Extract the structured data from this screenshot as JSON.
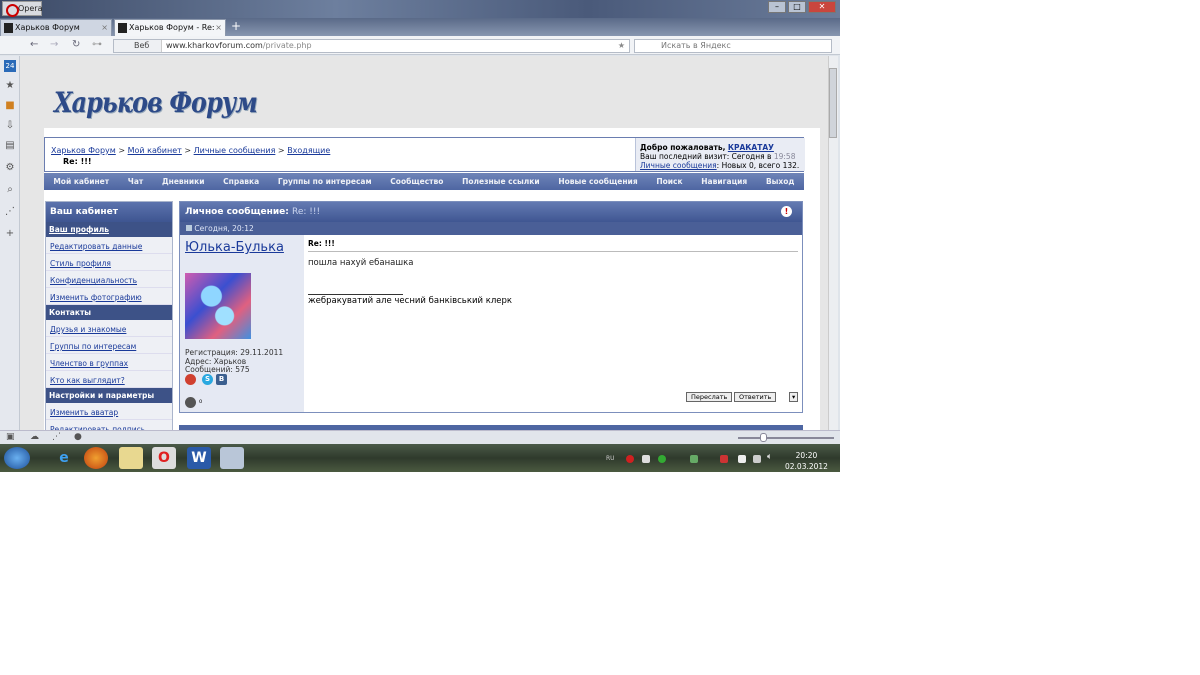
{
  "browser": {
    "menu_label": "Opera",
    "tabs": [
      {
        "label": "Харьков Форум"
      },
      {
        "label": "Харьков Форум - Re: !!!"
      }
    ],
    "address": {
      "mode": "Веб",
      "host": "www.kharkovforum.com",
      "path": "/private.php"
    },
    "search_placeholder": "Искать в Яндекс",
    "speed_dial_badge": "24"
  },
  "site": {
    "logo": "Харьков Форум",
    "breadcrumb": [
      "Харьков Форум",
      "Мой кабинет",
      "Личные сообщения",
      "Входящие"
    ],
    "current_title": "Re: !!!",
    "welcome": {
      "greeting": "Добро пожаловать,",
      "user": "КРАКАТАУ",
      "last_visit_label": "Ваш последний визит: Сегодня в",
      "last_visit_time": "19:58",
      "pm_link": "Личные сообщения",
      "pm_stats": ": Новых 0, всего 132."
    },
    "nav": [
      "Мой кабинет",
      "Чат",
      "Дневники",
      "Справка",
      "Группы по интересам",
      "Сообщество",
      "Полезные ссылки",
      "Новые сообщения",
      "Поиск",
      "Навигация",
      "Выход"
    ]
  },
  "sidebar": {
    "title": "Ваш кабинет",
    "sections": [
      {
        "label": "Ваш профиль",
        "items": [
          "Редактировать данные",
          "Стиль профиля",
          "Конфиденциальность",
          "Изменить фотографию"
        ]
      },
      {
        "label": "Контакты",
        "items": [
          "Друзья и знакомые",
          "Группы по интересам",
          "Членство в группах",
          "Кто как выглядит?"
        ]
      },
      {
        "label": "Настройки и параметры",
        "items": [
          "Изменить аватар",
          "Редактировать подпись"
        ]
      }
    ]
  },
  "message": {
    "header_label": "Личное сообщение:",
    "header_title": "Re: !!!",
    "date": "Сегодня, 20:12",
    "author": "Юлька-Булька",
    "registration": "Регистрация: 29.11.2011",
    "address": "Адрес: Харьков",
    "posts": "Сообщений: 575",
    "subject": "Re: !!!",
    "body": "пошла нахуй ебанашка",
    "signature": "жебракуватий але чесний банківський клерк",
    "forward_label": "Переслать",
    "reply_label": "Ответить"
  },
  "taskbar": {
    "time": "20:20",
    "date": "02.03.2012",
    "lang": "RU"
  }
}
